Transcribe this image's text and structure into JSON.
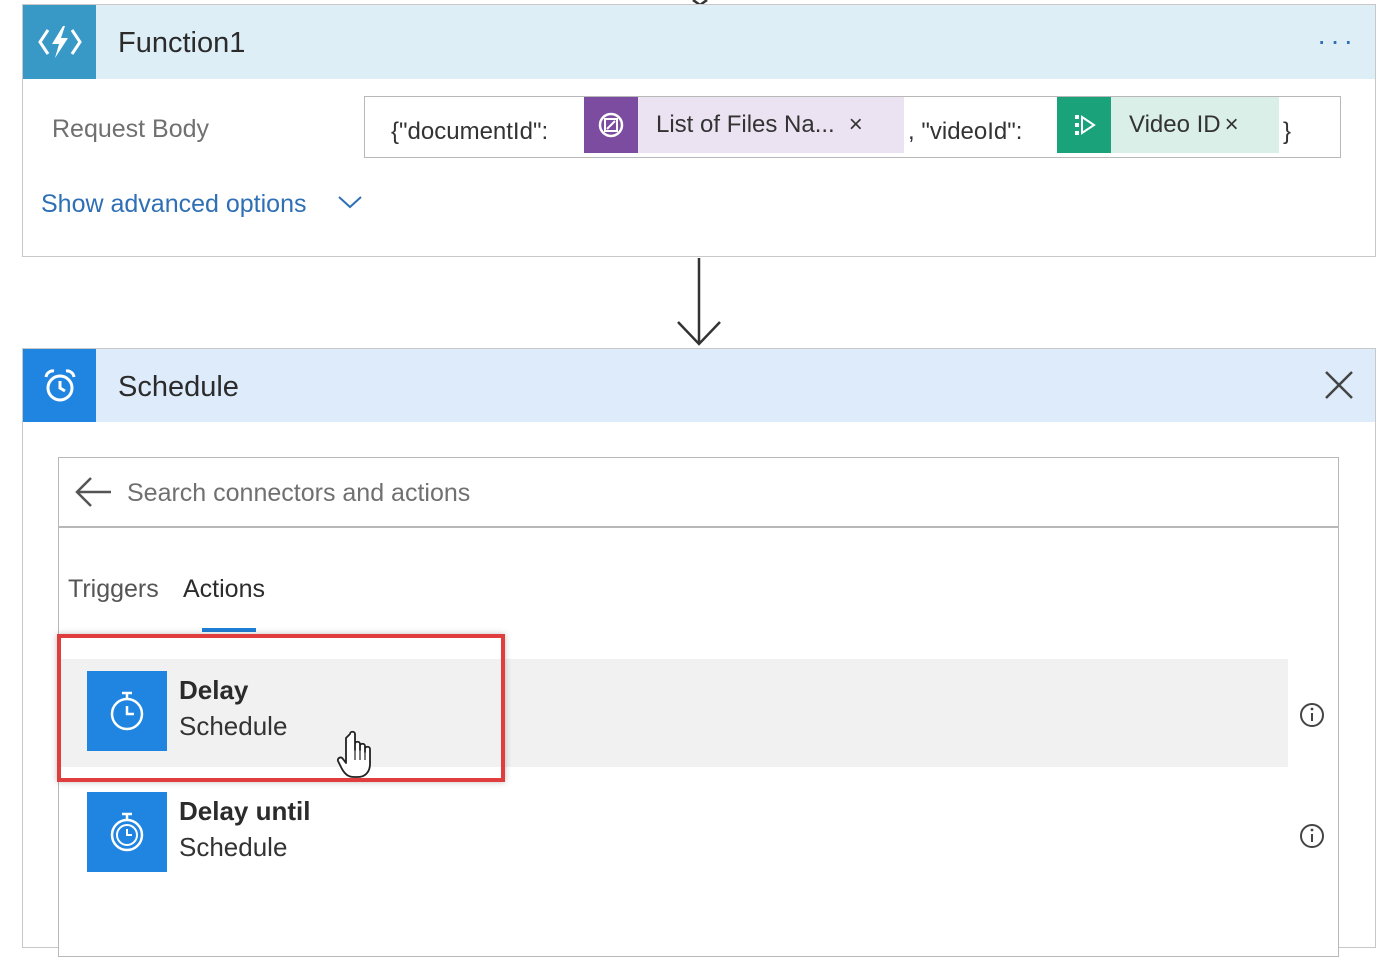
{
  "function_card": {
    "title": "Function1",
    "more_label": "···",
    "request_body": {
      "label": "Request Body",
      "text_open": "{\"documentId\":",
      "chip1_label": "List of Files Na...",
      "chip1_remove": "×",
      "text_mid": ", \"videoId\":",
      "chip2_label": "Video ID",
      "chip2_remove": "×",
      "text_close": "}"
    },
    "advanced_options": "Show advanced options"
  },
  "schedule_card": {
    "title": "Schedule",
    "search": {
      "placeholder": "Search connectors and actions"
    },
    "tabs": [
      {
        "label": "Triggers",
        "active": false
      },
      {
        "label": "Actions",
        "active": true
      }
    ],
    "actions": [
      {
        "title": "Delay",
        "connector": "Schedule",
        "icon": "timer-icon",
        "hovered": true
      },
      {
        "title": "Delay until",
        "connector": "Schedule",
        "icon": "timer-icon",
        "hovered": false
      }
    ]
  },
  "colors": {
    "function_accent": "#3999c6",
    "schedule_accent": "#1f85e0",
    "chip1_accent": "#7b4ca0",
    "chip2_accent": "#1aa37a",
    "link": "#2e6fb5",
    "highlight_border": "#e03e3e"
  }
}
